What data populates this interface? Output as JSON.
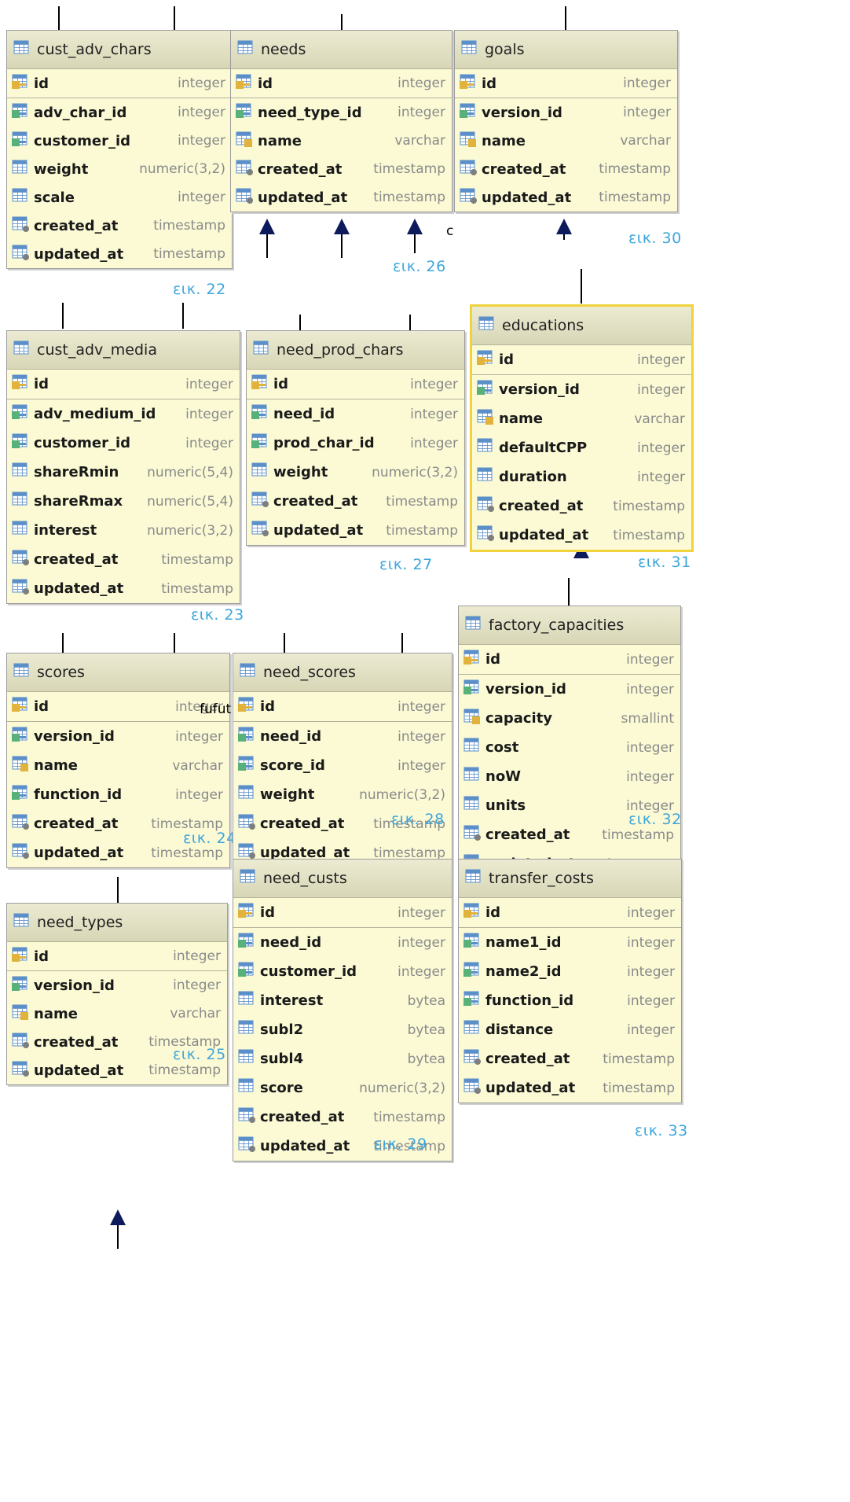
{
  "tables": [
    {
      "id": "cust_adv_chars",
      "title": "cust_adv_chars",
      "caption": "εικ. 22",
      "selected": false,
      "columns": [
        {
          "name": "id",
          "type": "integer",
          "kind": "pk"
        },
        {
          "name": "adv_char_id",
          "type": "integer",
          "kind": "fk"
        },
        {
          "name": "customer_id",
          "type": "integer",
          "kind": "fk"
        },
        {
          "name": "weight",
          "type": "numeric(3,2)",
          "kind": "col"
        },
        {
          "name": "scale",
          "type": "integer",
          "kind": "col"
        },
        {
          "name": "created_at",
          "type": "timestamp",
          "kind": "ts"
        },
        {
          "name": "updated_at",
          "type": "timestamp",
          "kind": "ts"
        }
      ]
    },
    {
      "id": "needs",
      "title": "needs",
      "caption": "εικ. 26",
      "selected": false,
      "columns": [
        {
          "name": "id",
          "type": "integer",
          "kind": "pk"
        },
        {
          "name": "need_type_id",
          "type": "integer",
          "kind": "fk"
        },
        {
          "name": "name",
          "type": "varchar",
          "kind": "uk"
        },
        {
          "name": "created_at",
          "type": "timestamp",
          "kind": "ts"
        },
        {
          "name": "updated_at",
          "type": "timestamp",
          "kind": "ts"
        }
      ]
    },
    {
      "id": "goals",
      "title": "goals",
      "caption": "εικ. 30",
      "selected": false,
      "columns": [
        {
          "name": "id",
          "type": "integer",
          "kind": "pk"
        },
        {
          "name": "version_id",
          "type": "integer",
          "kind": "fk"
        },
        {
          "name": "name",
          "type": "varchar",
          "kind": "uk"
        },
        {
          "name": "created_at",
          "type": "timestamp",
          "kind": "ts"
        },
        {
          "name": "updated_at",
          "type": "timestamp",
          "kind": "ts"
        }
      ]
    },
    {
      "id": "cust_adv_media",
      "title": "cust_adv_media",
      "caption": "εικ. 23",
      "selected": false,
      "columns": [
        {
          "name": "id",
          "type": "integer",
          "kind": "pk"
        },
        {
          "name": "adv_medium_id",
          "type": "integer",
          "kind": "fk"
        },
        {
          "name": "customer_id",
          "type": "integer",
          "kind": "fk"
        },
        {
          "name": "shareRmin",
          "type": "numeric(5,4)",
          "kind": "col"
        },
        {
          "name": "shareRmax",
          "type": "numeric(5,4)",
          "kind": "col"
        },
        {
          "name": "interest",
          "type": "numeric(3,2)",
          "kind": "col"
        },
        {
          "name": "created_at",
          "type": "timestamp",
          "kind": "ts"
        },
        {
          "name": "updated_at",
          "type": "timestamp",
          "kind": "ts"
        }
      ]
    },
    {
      "id": "need_prod_chars",
      "title": "need_prod_chars",
      "caption": "εικ. 27",
      "selected": false,
      "columns": [
        {
          "name": "id",
          "type": "integer",
          "kind": "pk"
        },
        {
          "name": "need_id",
          "type": "integer",
          "kind": "fk"
        },
        {
          "name": "prod_char_id",
          "type": "integer",
          "kind": "fk"
        },
        {
          "name": "weight",
          "type": "numeric(3,2)",
          "kind": "col"
        },
        {
          "name": "created_at",
          "type": "timestamp",
          "kind": "ts"
        },
        {
          "name": "updated_at",
          "type": "timestamp",
          "kind": "ts"
        }
      ]
    },
    {
      "id": "educations",
      "title": "educations",
      "caption": "εικ. 31",
      "selected": true,
      "columns": [
        {
          "name": "id",
          "type": "integer",
          "kind": "pk"
        },
        {
          "name": "version_id",
          "type": "integer",
          "kind": "fk"
        },
        {
          "name": "name",
          "type": "varchar",
          "kind": "uk"
        },
        {
          "name": "defaultCPP",
          "type": "integer",
          "kind": "col"
        },
        {
          "name": "duration",
          "type": "integer",
          "kind": "col"
        },
        {
          "name": "created_at",
          "type": "timestamp",
          "kind": "ts"
        },
        {
          "name": "updated_at",
          "type": "timestamp",
          "kind": "ts"
        }
      ]
    },
    {
      "id": "factory_capacities",
      "title": "factory_capacities",
      "caption": "εικ. 32",
      "selected": false,
      "columns": [
        {
          "name": "id",
          "type": "integer",
          "kind": "pk"
        },
        {
          "name": "version_id",
          "type": "integer",
          "kind": "fk"
        },
        {
          "name": "capacity",
          "type": "smallint",
          "kind": "uk"
        },
        {
          "name": "cost",
          "type": "integer",
          "kind": "col"
        },
        {
          "name": "noW",
          "type": "integer",
          "kind": "col"
        },
        {
          "name": "units",
          "type": "integer",
          "kind": "col"
        },
        {
          "name": "created_at",
          "type": "timestamp",
          "kind": "ts"
        },
        {
          "name": "updated_at",
          "type": "timestamp",
          "kind": "ts"
        }
      ]
    },
    {
      "id": "scores",
      "title": "scores",
      "caption": "εικ. 24",
      "selected": false,
      "columns": [
        {
          "name": "id",
          "type": "integer",
          "kind": "pk"
        },
        {
          "name": "version_id",
          "type": "integer",
          "kind": "fk"
        },
        {
          "name": "name",
          "type": "varchar",
          "kind": "uk"
        },
        {
          "name": "function_id",
          "type": "integer",
          "kind": "fk"
        },
        {
          "name": "created_at",
          "type": "timestamp",
          "kind": "ts"
        },
        {
          "name": "updated_at",
          "type": "timestamp",
          "kind": "ts"
        }
      ]
    },
    {
      "id": "need_scores",
      "title": "need_scores",
      "caption": "εικ. 28",
      "selected": false,
      "columns": [
        {
          "name": "id",
          "type": "integer",
          "kind": "pk"
        },
        {
          "name": "need_id",
          "type": "integer",
          "kind": "fk"
        },
        {
          "name": "score_id",
          "type": "integer",
          "kind": "fk"
        },
        {
          "name": "weight",
          "type": "numeric(3,2)",
          "kind": "col"
        },
        {
          "name": "created_at",
          "type": "timestamp",
          "kind": "ts"
        },
        {
          "name": "updated_at",
          "type": "timestamp",
          "kind": "ts"
        }
      ]
    },
    {
      "id": "need_types",
      "title": "need_types",
      "caption": "εικ. 25",
      "selected": false,
      "columns": [
        {
          "name": "id",
          "type": "integer",
          "kind": "pk"
        },
        {
          "name": "version_id",
          "type": "integer",
          "kind": "fk"
        },
        {
          "name": "name",
          "type": "varchar",
          "kind": "uk"
        },
        {
          "name": "created_at",
          "type": "timestamp",
          "kind": "ts"
        },
        {
          "name": "updated_at",
          "type": "timestamp",
          "kind": "ts"
        }
      ]
    },
    {
      "id": "need_custs",
      "title": "need_custs",
      "caption": "εικ. 29",
      "selected": false,
      "columns": [
        {
          "name": "id",
          "type": "integer",
          "kind": "pk"
        },
        {
          "name": "need_id",
          "type": "integer",
          "kind": "fk"
        },
        {
          "name": "customer_id",
          "type": "integer",
          "kind": "fk"
        },
        {
          "name": "interest",
          "type": "bytea",
          "kind": "col"
        },
        {
          "name": "subl2",
          "type": "bytea",
          "kind": "col"
        },
        {
          "name": "subl4",
          "type": "bytea",
          "kind": "col"
        },
        {
          "name": "score",
          "type": "numeric(3,2)",
          "kind": "col"
        },
        {
          "name": "created_at",
          "type": "timestamp",
          "kind": "ts"
        },
        {
          "name": "updated_at",
          "type": "timestamp",
          "kind": "ts"
        }
      ]
    },
    {
      "id": "transfer_costs",
      "title": "transfer_costs",
      "caption": "εικ. 33",
      "selected": false,
      "columns": [
        {
          "name": "id",
          "type": "integer",
          "kind": "pk"
        },
        {
          "name": "name1_id",
          "type": "integer",
          "kind": "fk"
        },
        {
          "name": "name2_id",
          "type": "integer",
          "kind": "fk"
        },
        {
          "name": "function_id",
          "type": "integer",
          "kind": "fk"
        },
        {
          "name": "distance",
          "type": "integer",
          "kind": "col"
        },
        {
          "name": "created_at",
          "type": "timestamp",
          "kind": "ts"
        },
        {
          "name": "updated_at",
          "type": "timestamp",
          "kind": "ts"
        }
      ]
    }
  ],
  "stray_text": {
    "c": "c",
    "fufu": "fufut"
  },
  "colors": {
    "header": "#e1e0c4",
    "body": "#fbfad5",
    "selected_border": "#f0d23c",
    "caption": "#3da6dc",
    "arrow": "#0d1b5c",
    "icon_blue": "#5b8fc9",
    "icon_gold": "#e1b33c",
    "icon_green": "#58b07b"
  }
}
